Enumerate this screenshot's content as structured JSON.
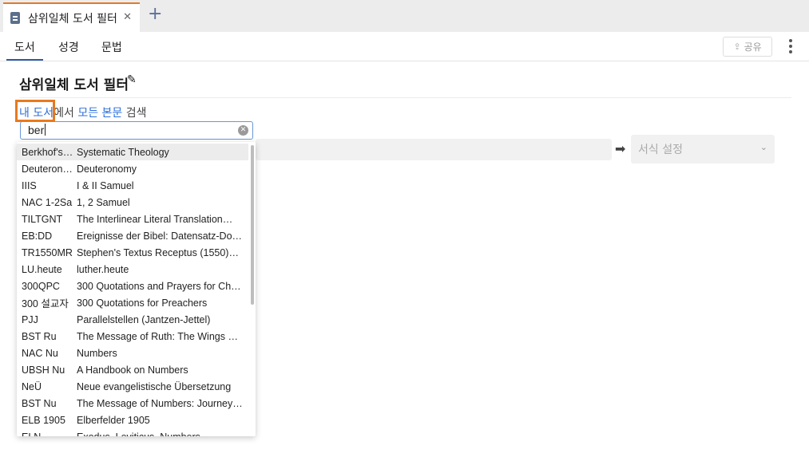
{
  "tab": {
    "title": "삼위일체 도서 필터",
    "close": "✕",
    "add": "+"
  },
  "nav": {
    "tabs": [
      "도서",
      "성경",
      "문법"
    ],
    "share_label": "공유"
  },
  "heading": "삼위일체 도서 필터",
  "sentence": {
    "my_library": "내 도서",
    "in": "에서",
    "all_text": "모든 본문",
    "search": "검색"
  },
  "search_input": {
    "value": "ber"
  },
  "format_select": {
    "placeholder": "서식 설정"
  },
  "colors": {
    "accent": "#2e6fd9",
    "highlight": "#e8791f",
    "tab_accent": "#e07b2a"
  },
  "dropdown": {
    "items": [
      {
        "abbr": "Berkhof's…",
        "name": "Systematic Theology"
      },
      {
        "abbr": "Deuteron…",
        "name": "Deuteronomy"
      },
      {
        "abbr": "IIIS",
        "name": "I & II Samuel"
      },
      {
        "abbr": "NAC 1-2Sa",
        "name": "1, 2 Samuel"
      },
      {
        "abbr": "TILTGNT",
        "name": "The Interlinear Literal Translation…"
      },
      {
        "abbr": "EB:DD",
        "name": "Ereignisse der Bibel: Datensatz-Do…"
      },
      {
        "abbr": "TR1550MR",
        "name": "Stephen's Textus Receptus (1550)…"
      },
      {
        "abbr": "LU.heute",
        "name": "luther.heute"
      },
      {
        "abbr": "300QPC",
        "name": "300 Quotations and Prayers for Chr…"
      },
      {
        "abbr": "300 설교자",
        "name": "300 Quotations for Preachers"
      },
      {
        "abbr": "PJJ",
        "name": "Parallelstellen (Jantzen-Jettel)"
      },
      {
        "abbr": "BST Ru",
        "name": "The Message of Ruth: The Wings of…"
      },
      {
        "abbr": "NAC Nu",
        "name": "Numbers"
      },
      {
        "abbr": "UBSH Nu",
        "name": "A Handbook on Numbers"
      },
      {
        "abbr": "NeÜ",
        "name": "Neue evangelistische Übersetzung"
      },
      {
        "abbr": "BST Nu",
        "name": "The Message of Numbers: Journey…"
      },
      {
        "abbr": "ELB 1905",
        "name": "Elberfelder 1905"
      },
      {
        "abbr": "ELN",
        "name": "Exodus, Leviticus, Numbers"
      }
    ]
  }
}
